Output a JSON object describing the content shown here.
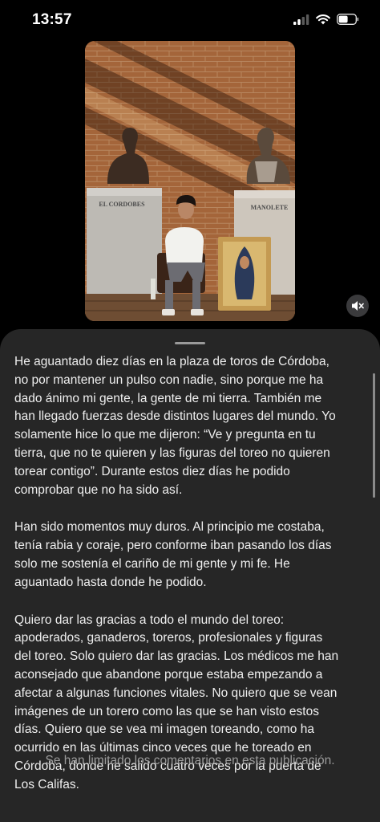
{
  "status_bar": {
    "time": "13:57"
  },
  "media": {
    "pedestal_left_label": "EL CORDOBES",
    "pedestal_right_label": "MANOLETE"
  },
  "caption": {
    "paragraph_1": "He aguantado diez días en la plaza de toros de Córdoba,\nno por mantener un pulso con nadie, sino porque me ha\ndado ánimo mi gente, la gente de mi tierra. También me\nhan llegado fuerzas desde distintos lugares del mundo. Yo\nsolamente hice lo que me dijeron: “Ve y pregunta en tu\ntierra, que no te quieren y las figuras del toreo no quieren\ntorear contigo”. Durante estos diez días he podido\ncomprobar que no ha sido así.",
    "paragraph_2": "Han sido momentos muy duros. Al principio me costaba,\ntenía rabia y coraje, pero conforme iban pasando los días\nsolo me sostenía el cariño de mi gente y mi fe. He\naguantado hasta donde he podido.",
    "paragraph_3": "Quiero dar las gracias a todo el mundo del toreo:\napoderados, ganaderos, toreros, profesionales y figuras\ndel toreo. Solo quiero dar las gracias. Los médicos me han\naconsejado que abandone porque estaba empezando a\nafectar a algunas funciones vitales. No quiero que se vean\nimágenes de un torero como las que se han visto estos\ndías. Quiero que se vea mi imagen toreando, como ha\nocurrido en las últimas cinco veces que he toreado en\nCórdoba, donde he salido cuatro veces por la puerta de\nLos Califas."
  },
  "comments_limited_text": "Se han limitado los comentarios en esta publicación."
}
